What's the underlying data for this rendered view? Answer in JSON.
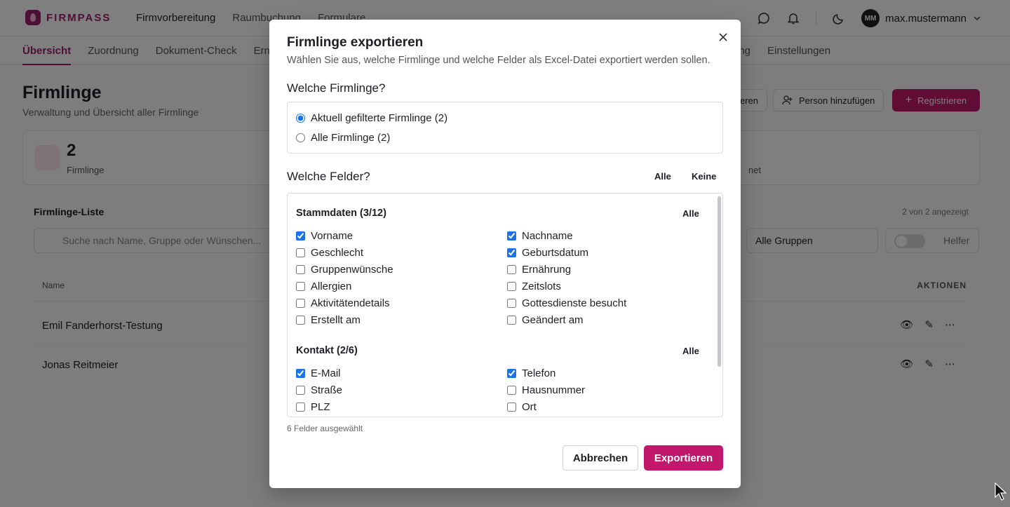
{
  "app": {
    "logo_text": "FIRMPASS",
    "brand_color": "#c2186b"
  },
  "topnav": {
    "items": [
      "Firmvorbereitung",
      "Raumbuchung",
      "Formulare"
    ],
    "active": "Firmvorbereitung"
  },
  "user": {
    "initials": "MM",
    "name": "max.mustermann"
  },
  "subnav": {
    "items_left": [
      "Übersicht",
      "Zuordnung",
      "Dokument-Check",
      "Ernä"
    ],
    "items_right": [
      "ing",
      "Einstellungen"
    ],
    "active": "Übersicht"
  },
  "page": {
    "title": "Firmlinge",
    "subtitle": "Verwaltung und Übersicht aller Firmlinge"
  },
  "header_buttons": {
    "partial": "eren",
    "add_person": "Person hinzufügen",
    "register": "Registrieren"
  },
  "stats": {
    "count": "2",
    "label": "Firmlinge",
    "right_label": "net"
  },
  "list": {
    "title": "Firmlinge-Liste",
    "count_text": "2 von 2 angezeigt",
    "search_placeholder": "Suche nach Name, Gruppe oder Wünschen...",
    "group_select": "Alle Gruppen",
    "toggle_label": "Helfer",
    "col_name": "Name",
    "col_actions": "AKTIONEN",
    "rows": [
      "Emil Fanderhorst-Testung",
      "Jonas Reitmeier"
    ]
  },
  "modal": {
    "title": "Firmlinge exportieren",
    "description": "Wählen Sie aus, welche Firmlinge und welche Felder als Excel-Datei exportiert werden sollen.",
    "which_title": "Welche Firmlinge?",
    "radio_options": [
      {
        "label": "Aktuell gefilterte Firmlinge (2)",
        "checked": true
      },
      {
        "label": "Alle Firmlinge (2)",
        "checked": false
      }
    ],
    "fields_title": "Welche Felder?",
    "all_label": "Alle",
    "none_label": "Keine",
    "groups": [
      {
        "title": "Stammdaten (3/12)",
        "all_label": "Alle",
        "fields": [
          {
            "label": "Vorname",
            "checked": true
          },
          {
            "label": "Nachname",
            "checked": true
          },
          {
            "label": "Geschlecht",
            "checked": false
          },
          {
            "label": "Geburtsdatum",
            "checked": true
          },
          {
            "label": "Gruppenwünsche",
            "checked": false
          },
          {
            "label": "Ernährung",
            "checked": false
          },
          {
            "label": "Allergien",
            "checked": false
          },
          {
            "label": "Zeitslots",
            "checked": false
          },
          {
            "label": "Aktivitätendetails",
            "checked": false
          },
          {
            "label": "Gottesdienste besucht",
            "checked": false
          },
          {
            "label": "Erstellt am",
            "checked": false
          },
          {
            "label": "Geändert am",
            "checked": false
          }
        ]
      },
      {
        "title": "Kontakt (2/6)",
        "all_label": "Alle",
        "fields": [
          {
            "label": "E-Mail",
            "checked": true
          },
          {
            "label": "Telefon",
            "checked": true
          },
          {
            "label": "Straße",
            "checked": false
          },
          {
            "label": "Hausnummer",
            "checked": false
          },
          {
            "label": "PLZ",
            "checked": false
          },
          {
            "label": "Ort",
            "checked": false
          }
        ]
      }
    ],
    "selected_count": "6 Felder ausgewählt",
    "cancel_label": "Abbrechen",
    "export_label": "Exportieren"
  }
}
